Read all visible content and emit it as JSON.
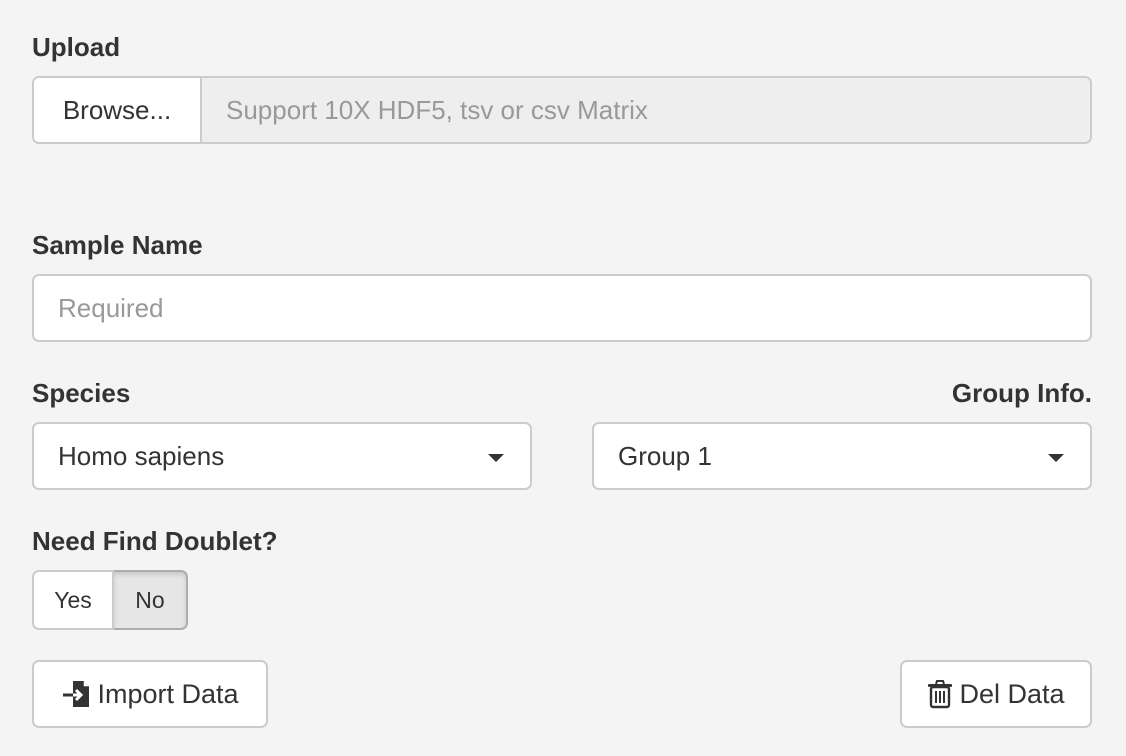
{
  "upload": {
    "label": "Upload",
    "browse_label": "Browse...",
    "placeholder": "Support 10X HDF5, tsv or csv Matrix"
  },
  "sample_name": {
    "label": "Sample Name",
    "placeholder": "Required",
    "value": ""
  },
  "species": {
    "label": "Species",
    "selected": "Homo sapiens"
  },
  "group_info": {
    "label": "Group Info.",
    "selected": "Group 1"
  },
  "doublet": {
    "label": "Need Find Doublet?",
    "options": [
      "Yes",
      "No"
    ],
    "selected": "No"
  },
  "buttons": {
    "import_label": "Import Data",
    "import_icon": "file-import-icon",
    "delete_label": "Del Data",
    "delete_icon": "trash-icon"
  }
}
